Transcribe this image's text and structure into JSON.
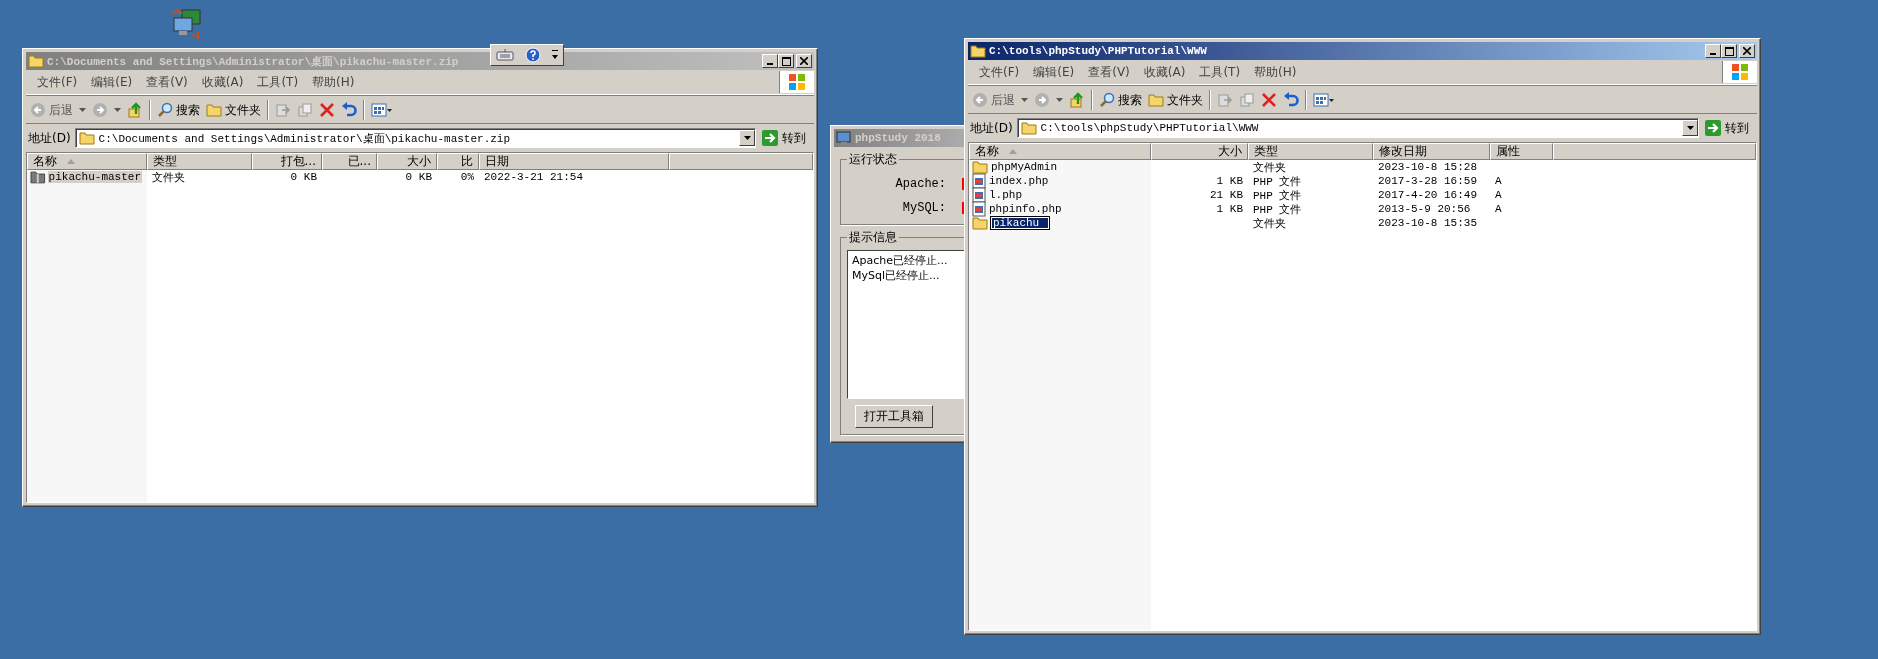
{
  "explorers": [
    {
      "title": "C:\\Documents and Settings\\Administrator\\桌面\\pikachu-master.zip",
      "active": false,
      "menu": [
        "文件(F)",
        "编辑(E)",
        "查看(V)",
        "收藏(A)",
        "工具(T)",
        "帮助(H)"
      ],
      "toolbar": {
        "back": "后退",
        "search": "搜索",
        "folders": "文件夹"
      },
      "address": {
        "label": "地址(D)",
        "value": "C:\\Documents and Settings\\Administrator\\桌面\\pikachu-master.zip",
        "go": "转到"
      },
      "columns": [
        {
          "label": "名称",
          "sorted": true
        },
        {
          "label": "类型",
          "sorted": false
        },
        {
          "label": "打包...",
          "sorted": false
        },
        {
          "label": "已...",
          "sorted": false
        },
        {
          "label": "大小",
          "sorted": false
        },
        {
          "label": "比",
          "sorted": false
        },
        {
          "label": "日期",
          "sorted": false
        }
      ],
      "rows": [
        {
          "kind": "zip-folder",
          "selected": true,
          "editing": false,
          "cells": [
            "pikachu-master",
            "文件夹",
            "0 KB",
            "",
            "0 KB",
            "0%",
            "2022-3-21 21:54"
          ]
        }
      ]
    },
    {
      "title": "C:\\tools\\phpStudy\\PHPTutorial\\WWW",
      "active": true,
      "menu": [
        "文件(F)",
        "编辑(E)",
        "查看(V)",
        "收藏(A)",
        "工具(T)",
        "帮助(H)"
      ],
      "toolbar": {
        "back": "后退",
        "search": "搜索",
        "folders": "文件夹"
      },
      "address": {
        "label": "地址(D)",
        "value": "C:\\tools\\phpStudy\\PHPTutorial\\WWW",
        "go": "转到"
      },
      "columns": [
        {
          "label": "名称",
          "sorted": true
        },
        {
          "label": "大小",
          "sorted": false
        },
        {
          "label": "类型",
          "sorted": false
        },
        {
          "label": "修改日期",
          "sorted": false
        },
        {
          "label": "属性",
          "sorted": false
        }
      ],
      "rows": [
        {
          "kind": "folder",
          "selected": false,
          "editing": false,
          "cells": [
            "phpMyAdmin",
            "",
            "文件夹",
            "2023-10-8 15:28",
            ""
          ]
        },
        {
          "kind": "php",
          "selected": false,
          "editing": false,
          "cells": [
            "index.php",
            "1 KB",
            "PHP 文件",
            "2017-3-28 16:59",
            "A"
          ]
        },
        {
          "kind": "php",
          "selected": false,
          "editing": false,
          "cells": [
            "l.php",
            "21 KB",
            "PHP 文件",
            "2017-4-20 16:49",
            "A"
          ]
        },
        {
          "kind": "php",
          "selected": false,
          "editing": false,
          "cells": [
            "phpinfo.php",
            "1 KB",
            "PHP 文件",
            "2013-5-9 20:56",
            "A"
          ]
        },
        {
          "kind": "folder",
          "selected": true,
          "editing": true,
          "cells": [
            "pikachu",
            "",
            "文件夹",
            "2023-10-8 15:35",
            ""
          ]
        }
      ]
    }
  ],
  "phpstudy": {
    "title": "phpStudy 2018",
    "status_group": "运行状态",
    "services": [
      {
        "name": "Apache:",
        "running": false
      },
      {
        "name": "MySQL:",
        "running": false
      }
    ],
    "info_group": "提示信息",
    "log": [
      "Apache已经停止...",
      "MySql已经停止..."
    ],
    "button": "打开工具箱"
  }
}
